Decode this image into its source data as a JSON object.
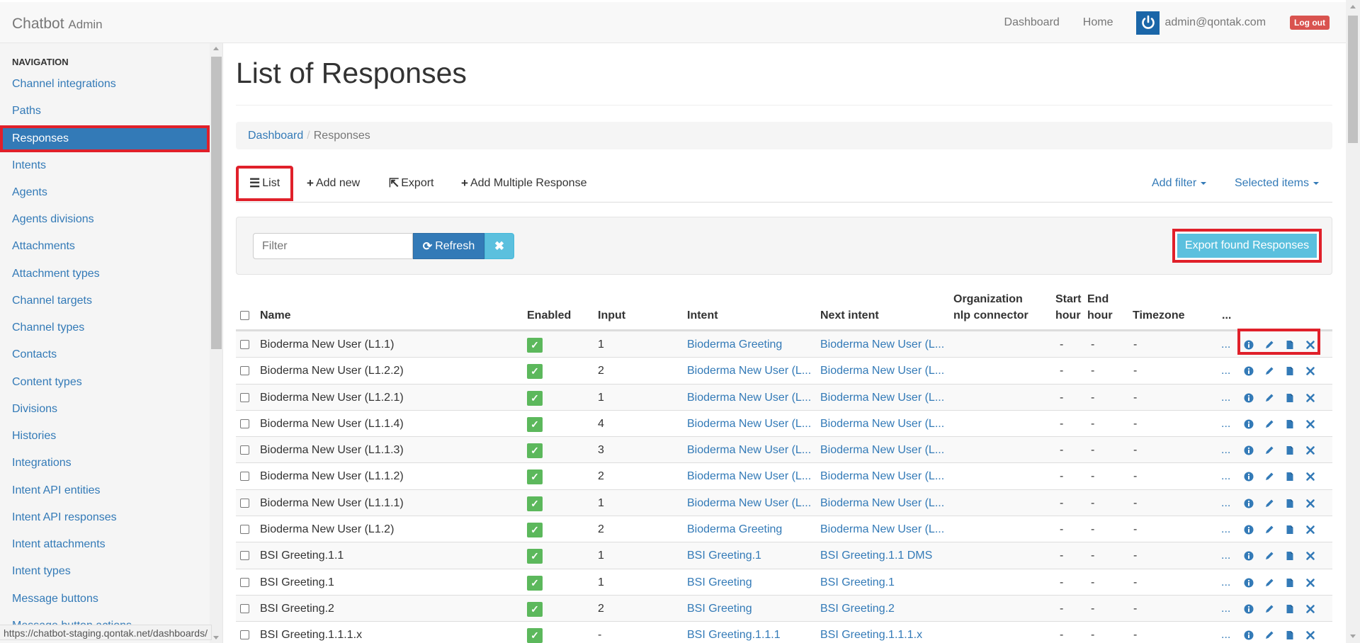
{
  "navbar": {
    "brand": "Chatbot",
    "brand_sub": "Admin",
    "links": [
      "Dashboard",
      "Home"
    ],
    "user_email": "admin@qontak.com",
    "logout": "Log out"
  },
  "sidebar": {
    "heading": "NAVIGATION",
    "items": [
      {
        "label": "Channel integrations",
        "active": false
      },
      {
        "label": "Paths",
        "active": false
      },
      {
        "label": "Responses",
        "active": true
      },
      {
        "label": "Intents",
        "active": false
      },
      {
        "label": "Agents",
        "active": false
      },
      {
        "label": "Agents divisions",
        "active": false
      },
      {
        "label": "Attachments",
        "active": false
      },
      {
        "label": "Attachment types",
        "active": false
      },
      {
        "label": "Channel targets",
        "active": false
      },
      {
        "label": "Channel types",
        "active": false
      },
      {
        "label": "Contacts",
        "active": false
      },
      {
        "label": "Content types",
        "active": false
      },
      {
        "label": "Divisions",
        "active": false
      },
      {
        "label": "Histories",
        "active": false
      },
      {
        "label": "Integrations",
        "active": false
      },
      {
        "label": "Intent API entities",
        "active": false
      },
      {
        "label": "Intent API responses",
        "active": false
      },
      {
        "label": "Intent attachments",
        "active": false
      },
      {
        "label": "Intent types",
        "active": false
      },
      {
        "label": "Message buttons",
        "active": false
      },
      {
        "label": "Message button actions",
        "active": false
      }
    ]
  },
  "status_url": "https://chatbot-staging.qontak.net/dashboards/",
  "page": {
    "title": "List of Responses",
    "breadcrumb": {
      "root": "Dashboard",
      "current": "Responses"
    }
  },
  "tabs": {
    "list": "List",
    "add_new": "Add new",
    "export": "Export",
    "add_multiple": "Add Multiple Response",
    "add_filter": "Add filter",
    "selected_items": "Selected items"
  },
  "filter": {
    "placeholder": "Filter",
    "refresh": "Refresh",
    "export_found": "Export found Responses"
  },
  "table": {
    "headers": {
      "name": "Name",
      "enabled": "Enabled",
      "input": "Input",
      "intent": "Intent",
      "next_intent": "Next intent",
      "org_nlp_1": "Organization",
      "org_nlp_2": "nlp connector",
      "start_1": "Start",
      "start_2": "hour",
      "end_1": "End",
      "end_2": "hour",
      "timezone": "Timezone",
      "more": "..."
    },
    "rows": [
      {
        "name": "Bioderma New User (L1.1)",
        "input": "1",
        "intent": "Bioderma Greeting",
        "next_intent": "Bioderma New User (L...",
        "start": "-",
        "end": "-",
        "tz": "-",
        "more": "..."
      },
      {
        "name": "Bioderma New User (L1.2.2)",
        "input": "2",
        "intent": "Bioderma New User (L...",
        "next_intent": "Bioderma New User (L...",
        "start": "-",
        "end": "-",
        "tz": "-",
        "more": "..."
      },
      {
        "name": "Bioderma New User (L1.2.1)",
        "input": "1",
        "intent": "Bioderma New User (L...",
        "next_intent": "Bioderma New User (L...",
        "start": "-",
        "end": "-",
        "tz": "-",
        "more": "..."
      },
      {
        "name": "Bioderma New User (L1.1.4)",
        "input": "4",
        "intent": "Bioderma New User (L...",
        "next_intent": "Bioderma New User (L...",
        "start": "-",
        "end": "-",
        "tz": "-",
        "more": "..."
      },
      {
        "name": "Bioderma New User (L1.1.3)",
        "input": "3",
        "intent": "Bioderma New User (L...",
        "next_intent": "Bioderma New User (L...",
        "start": "-",
        "end": "-",
        "tz": "-",
        "more": "..."
      },
      {
        "name": "Bioderma New User (L1.1.2)",
        "input": "2",
        "intent": "Bioderma New User (L...",
        "next_intent": "Bioderma New User (L...",
        "start": "-",
        "end": "-",
        "tz": "-",
        "more": "..."
      },
      {
        "name": "Bioderma New User (L1.1.1)",
        "input": "1",
        "intent": "Bioderma New User (L...",
        "next_intent": "Bioderma New User (L...",
        "start": "-",
        "end": "-",
        "tz": "-",
        "more": "..."
      },
      {
        "name": "Bioderma New User (L1.2)",
        "input": "2",
        "intent": "Bioderma Greeting",
        "next_intent": "Bioderma New User (L...",
        "start": "-",
        "end": "-",
        "tz": "-",
        "more": "..."
      },
      {
        "name": "BSI Greeting.1.1",
        "input": "1",
        "intent": "BSI Greeting.1",
        "next_intent": "BSI Greeting.1.1 DMS",
        "start": "-",
        "end": "-",
        "tz": "-",
        "more": "..."
      },
      {
        "name": "BSI Greeting.1",
        "input": "1",
        "intent": "BSI Greeting",
        "next_intent": "BSI Greeting.1",
        "start": "-",
        "end": "-",
        "tz": "-",
        "more": "..."
      },
      {
        "name": "BSI Greeting.2",
        "input": "2",
        "intent": "BSI Greeting",
        "next_intent": "BSI Greeting.2",
        "start": "-",
        "end": "-",
        "tz": "-",
        "more": "..."
      },
      {
        "name": "BSI Greeting.1.1.1.x",
        "input": "-",
        "intent": "BSI Greeting.1.1.1",
        "next_intent": "BSI Greeting.1.1.1.x",
        "start": "-",
        "end": "-",
        "tz": "-",
        "more": "..."
      }
    ]
  },
  "colors": {
    "primary": "#337ab7",
    "info": "#5bc0de",
    "success": "#5cb85c",
    "danger": "#d9534f",
    "highlight": "#e0202a"
  }
}
